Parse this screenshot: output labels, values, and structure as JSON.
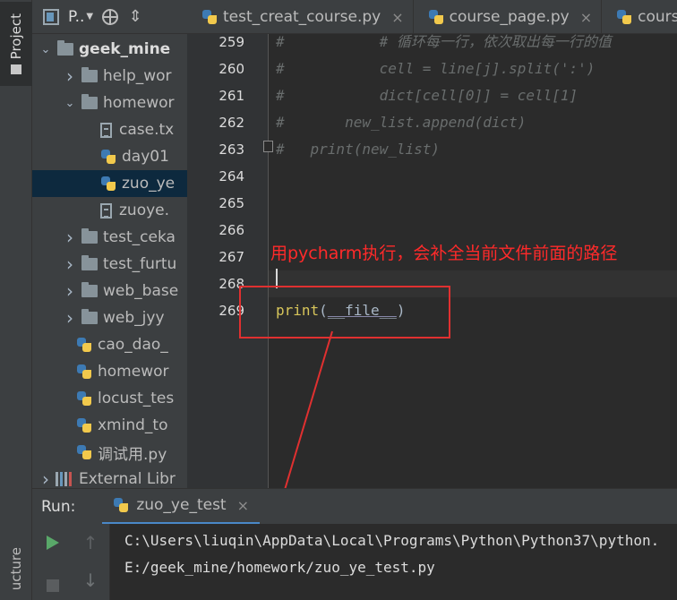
{
  "sidebar": {
    "project_tab": "Project",
    "structure_tab": "ucture"
  },
  "project_panel": {
    "title": "P..",
    "tree": [
      {
        "label": "geek_mine",
        "type": "folder",
        "arrow": "open",
        "indent": 0,
        "bold": true
      },
      {
        "label": "help_wor",
        "type": "folder",
        "arrow": "closed",
        "indent": 1
      },
      {
        "label": "homewor",
        "type": "folder",
        "arrow": "open",
        "indent": 1
      },
      {
        "label": "case.tx",
        "type": "txt",
        "indent": 2
      },
      {
        "label": "day01",
        "type": "py",
        "indent": 2
      },
      {
        "label": "zuo_ye",
        "type": "py",
        "indent": 2,
        "selected": true
      },
      {
        "label": "zuoye.",
        "type": "txt",
        "indent": 2
      },
      {
        "label": "test_ceka",
        "type": "folder",
        "arrow": "closed",
        "indent": 1
      },
      {
        "label": "test_furtu",
        "type": "folder",
        "arrow": "closed",
        "indent": 1
      },
      {
        "label": "web_base",
        "type": "folder",
        "arrow": "closed",
        "indent": 1
      },
      {
        "label": "web_jyy",
        "type": "folder",
        "arrow": "closed",
        "indent": 1
      },
      {
        "label": "cao_dao_",
        "type": "py",
        "indent": 1
      },
      {
        "label": "homewor",
        "type": "py",
        "indent": 1
      },
      {
        "label": "locust_tes",
        "type": "py",
        "indent": 1
      },
      {
        "label": "xmind_to",
        "type": "py",
        "indent": 1
      },
      {
        "label": "调试用.py",
        "type": "py",
        "indent": 1
      },
      {
        "label": "External Libr",
        "type": "lib",
        "arrow": "closed",
        "indent": 0
      }
    ]
  },
  "editor_tabs": [
    {
      "label": "test_creat_course.py",
      "close": "×"
    },
    {
      "label": "course_page.py",
      "close": "×"
    },
    {
      "label": "cours",
      "close": ""
    }
  ],
  "editor": {
    "lines": [
      {
        "no": "259",
        "text": "#           # 循环每一行，依次取出每一行的值",
        "style": "comment"
      },
      {
        "no": "260",
        "text": "#           cell = line[j].split(':')",
        "style": "comment"
      },
      {
        "no": "261",
        "text": "#           dict[cell[0]] = cell[1]",
        "style": "comment"
      },
      {
        "no": "262",
        "text": "#       new_list.append(dict)",
        "style": "comment"
      },
      {
        "no": "263",
        "text": "#   print(new_list)",
        "style": "comment"
      },
      {
        "no": "264",
        "text": "",
        "style": "code"
      },
      {
        "no": "265",
        "text": "",
        "style": "code"
      },
      {
        "no": "266",
        "text": "",
        "style": "code"
      },
      {
        "no": "267",
        "text": "",
        "style": "code"
      },
      {
        "no": "268",
        "text": "",
        "style": "current"
      },
      {
        "no": "269",
        "text": "",
        "style": "code"
      }
    ],
    "print_stmt": {
      "func": "print",
      "open": "(",
      "arg": "__file__",
      "close": ")"
    }
  },
  "annotation": {
    "text": "用pycharm执行，会补全当前文件前面的路径",
    "color": "#ff2a2a"
  },
  "run_panel": {
    "label": "Run:",
    "tab_label": "zuo_ye_test",
    "tab_close": "×",
    "console": [
      "C:\\Users\\liuqin\\AppData\\Local\\Programs\\Python\\Python37\\python.",
      "E:/geek_mine/homework/zuo_ye_test.py"
    ]
  },
  "icons": {
    "project_view": "project-view-icon",
    "locate": "target-icon",
    "collapse": "collapse-all-icon",
    "rerun": "run-icon",
    "stop": "stop-icon",
    "up": "arrow-up-icon",
    "down": "arrow-down-icon"
  },
  "colors": {
    "accent": "#4a88c7",
    "selection": "#0d293e",
    "run_green": "#59a869",
    "python_blue": "#3d7ab3",
    "python_yellow": "#f2c94c"
  }
}
